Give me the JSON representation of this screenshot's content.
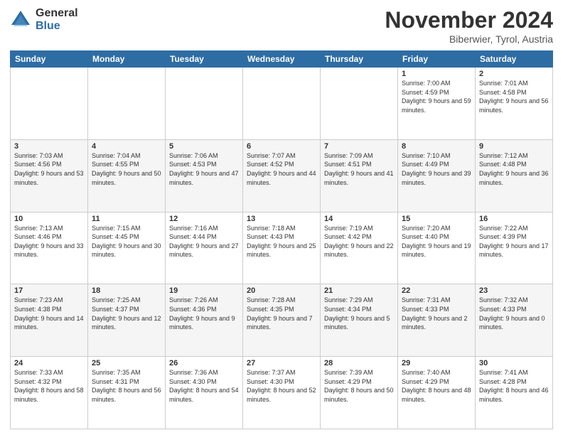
{
  "logo": {
    "general": "General",
    "blue": "Blue"
  },
  "header": {
    "month": "November 2024",
    "location": "Biberwier, Tyrol, Austria"
  },
  "days_of_week": [
    "Sunday",
    "Monday",
    "Tuesday",
    "Wednesday",
    "Thursday",
    "Friday",
    "Saturday"
  ],
  "weeks": [
    [
      {
        "day": "",
        "info": ""
      },
      {
        "day": "",
        "info": ""
      },
      {
        "day": "",
        "info": ""
      },
      {
        "day": "",
        "info": ""
      },
      {
        "day": "",
        "info": ""
      },
      {
        "day": "1",
        "info": "Sunrise: 7:00 AM\nSunset: 4:59 PM\nDaylight: 9 hours and 59 minutes."
      },
      {
        "day": "2",
        "info": "Sunrise: 7:01 AM\nSunset: 4:58 PM\nDaylight: 9 hours and 56 minutes."
      }
    ],
    [
      {
        "day": "3",
        "info": "Sunrise: 7:03 AM\nSunset: 4:56 PM\nDaylight: 9 hours and 53 minutes."
      },
      {
        "day": "4",
        "info": "Sunrise: 7:04 AM\nSunset: 4:55 PM\nDaylight: 9 hours and 50 minutes."
      },
      {
        "day": "5",
        "info": "Sunrise: 7:06 AM\nSunset: 4:53 PM\nDaylight: 9 hours and 47 minutes."
      },
      {
        "day": "6",
        "info": "Sunrise: 7:07 AM\nSunset: 4:52 PM\nDaylight: 9 hours and 44 minutes."
      },
      {
        "day": "7",
        "info": "Sunrise: 7:09 AM\nSunset: 4:51 PM\nDaylight: 9 hours and 41 minutes."
      },
      {
        "day": "8",
        "info": "Sunrise: 7:10 AM\nSunset: 4:49 PM\nDaylight: 9 hours and 39 minutes."
      },
      {
        "day": "9",
        "info": "Sunrise: 7:12 AM\nSunset: 4:48 PM\nDaylight: 9 hours and 36 minutes."
      }
    ],
    [
      {
        "day": "10",
        "info": "Sunrise: 7:13 AM\nSunset: 4:46 PM\nDaylight: 9 hours and 33 minutes."
      },
      {
        "day": "11",
        "info": "Sunrise: 7:15 AM\nSunset: 4:45 PM\nDaylight: 9 hours and 30 minutes."
      },
      {
        "day": "12",
        "info": "Sunrise: 7:16 AM\nSunset: 4:44 PM\nDaylight: 9 hours and 27 minutes."
      },
      {
        "day": "13",
        "info": "Sunrise: 7:18 AM\nSunset: 4:43 PM\nDaylight: 9 hours and 25 minutes."
      },
      {
        "day": "14",
        "info": "Sunrise: 7:19 AM\nSunset: 4:42 PM\nDaylight: 9 hours and 22 minutes."
      },
      {
        "day": "15",
        "info": "Sunrise: 7:20 AM\nSunset: 4:40 PM\nDaylight: 9 hours and 19 minutes."
      },
      {
        "day": "16",
        "info": "Sunrise: 7:22 AM\nSunset: 4:39 PM\nDaylight: 9 hours and 17 minutes."
      }
    ],
    [
      {
        "day": "17",
        "info": "Sunrise: 7:23 AM\nSunset: 4:38 PM\nDaylight: 9 hours and 14 minutes."
      },
      {
        "day": "18",
        "info": "Sunrise: 7:25 AM\nSunset: 4:37 PM\nDaylight: 9 hours and 12 minutes."
      },
      {
        "day": "19",
        "info": "Sunrise: 7:26 AM\nSunset: 4:36 PM\nDaylight: 9 hours and 9 minutes."
      },
      {
        "day": "20",
        "info": "Sunrise: 7:28 AM\nSunset: 4:35 PM\nDaylight: 9 hours and 7 minutes."
      },
      {
        "day": "21",
        "info": "Sunrise: 7:29 AM\nSunset: 4:34 PM\nDaylight: 9 hours and 5 minutes."
      },
      {
        "day": "22",
        "info": "Sunrise: 7:31 AM\nSunset: 4:33 PM\nDaylight: 9 hours and 2 minutes."
      },
      {
        "day": "23",
        "info": "Sunrise: 7:32 AM\nSunset: 4:33 PM\nDaylight: 9 hours and 0 minutes."
      }
    ],
    [
      {
        "day": "24",
        "info": "Sunrise: 7:33 AM\nSunset: 4:32 PM\nDaylight: 8 hours and 58 minutes."
      },
      {
        "day": "25",
        "info": "Sunrise: 7:35 AM\nSunset: 4:31 PM\nDaylight: 8 hours and 56 minutes."
      },
      {
        "day": "26",
        "info": "Sunrise: 7:36 AM\nSunset: 4:30 PM\nDaylight: 8 hours and 54 minutes."
      },
      {
        "day": "27",
        "info": "Sunrise: 7:37 AM\nSunset: 4:30 PM\nDaylight: 8 hours and 52 minutes."
      },
      {
        "day": "28",
        "info": "Sunrise: 7:39 AM\nSunset: 4:29 PM\nDaylight: 8 hours and 50 minutes."
      },
      {
        "day": "29",
        "info": "Sunrise: 7:40 AM\nSunset: 4:29 PM\nDaylight: 8 hours and 48 minutes."
      },
      {
        "day": "30",
        "info": "Sunrise: 7:41 AM\nSunset: 4:28 PM\nDaylight: 8 hours and 46 minutes."
      }
    ]
  ]
}
